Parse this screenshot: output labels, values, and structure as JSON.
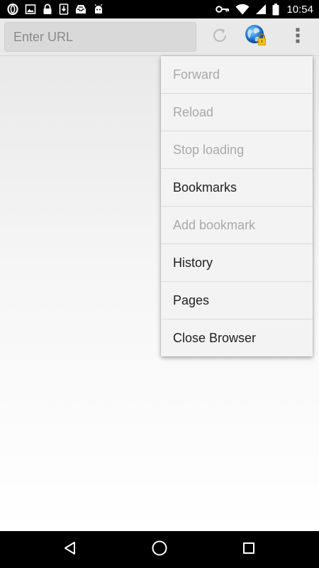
{
  "status_bar": {
    "time": "10:54",
    "left_icons": [
      "opera-icon",
      "image-icon",
      "lock-icon",
      "download-icon",
      "inbox-icon",
      "android-icon"
    ],
    "right_icons": [
      "vpn-key-icon",
      "wifi-icon",
      "signal-icon",
      "battery-icon"
    ]
  },
  "toolbar": {
    "url_placeholder": "Enter URL",
    "url_value": "",
    "buttons": [
      "reload-icon",
      "globe-lock-icon",
      "overflow-menu-icon"
    ]
  },
  "menu": {
    "items": [
      {
        "label": "Forward",
        "enabled": false
      },
      {
        "label": "Reload",
        "enabled": false
      },
      {
        "label": "Stop loading",
        "enabled": false
      },
      {
        "label": "Bookmarks",
        "enabled": true
      },
      {
        "label": "Add bookmark",
        "enabled": false
      },
      {
        "label": "History",
        "enabled": true
      },
      {
        "label": "Pages",
        "enabled": true
      },
      {
        "label": "Close Browser",
        "enabled": true
      }
    ]
  },
  "nav_bar": {
    "buttons": [
      "back-icon",
      "home-icon",
      "recents-icon"
    ]
  },
  "colors": {
    "status_bar": "#000000",
    "toolbar": "#e9e9e9",
    "menu_background": "#f3f3f3",
    "menu_text_enabled": "#212121",
    "menu_text_disabled": "#a9a9a9",
    "nav_bar": "#000000"
  }
}
